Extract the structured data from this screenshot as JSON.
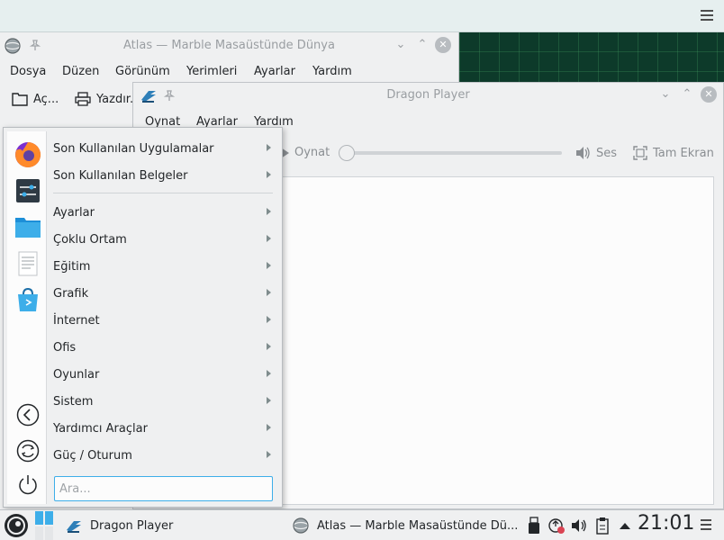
{
  "atlas_window": {
    "title": "Atlas — Marble Masaüstünde Dünya",
    "menu": [
      "Dosya",
      "Düzen",
      "Görünüm",
      "Yerimleri",
      "Ayarlar",
      "Yardım"
    ],
    "toolbar": {
      "open_label": "Aç...",
      "print_label": "Yazdır..."
    }
  },
  "dragon_window": {
    "title": "Dragon Player",
    "menu": [
      "Oynat",
      "Ayarlar",
      "Yardım"
    ],
    "toolbar": {
      "play_label": "Oynat",
      "volume_label": "Ses",
      "fullscreen_label": "Tam Ekran"
    },
    "seek_position": 0
  },
  "app_menu": {
    "favorites": [
      "firefox-icon",
      "system-settings-icon",
      "file-manager-icon",
      "text-editor-icon",
      "software-center-icon"
    ],
    "recent": [
      {
        "label": "Son Kullanılan Uygulamalar"
      },
      {
        "label": "Son Kullanılan Belgeler"
      }
    ],
    "categories": [
      {
        "label": "Ayarlar"
      },
      {
        "label": "Çoklu Ortam"
      },
      {
        "label": "Eğitim"
      },
      {
        "label": "Grafik"
      },
      {
        "label": "İnternet"
      },
      {
        "label": "Ofis"
      },
      {
        "label": "Oyunlar"
      },
      {
        "label": "Sistem"
      },
      {
        "label": "Yardımcı Araçlar"
      },
      {
        "label": "Güç / Oturum"
      }
    ],
    "search_placeholder": "Ara..."
  },
  "taskbar": {
    "tasks": [
      {
        "label": "Dragon Player"
      },
      {
        "label": "Atlas — Marble Masaüstünde Dü..."
      }
    ],
    "clock": "21:01"
  },
  "colors": {
    "accent": "#3daee9",
    "text": "#232629",
    "panel_bg": "#eff0f1"
  }
}
